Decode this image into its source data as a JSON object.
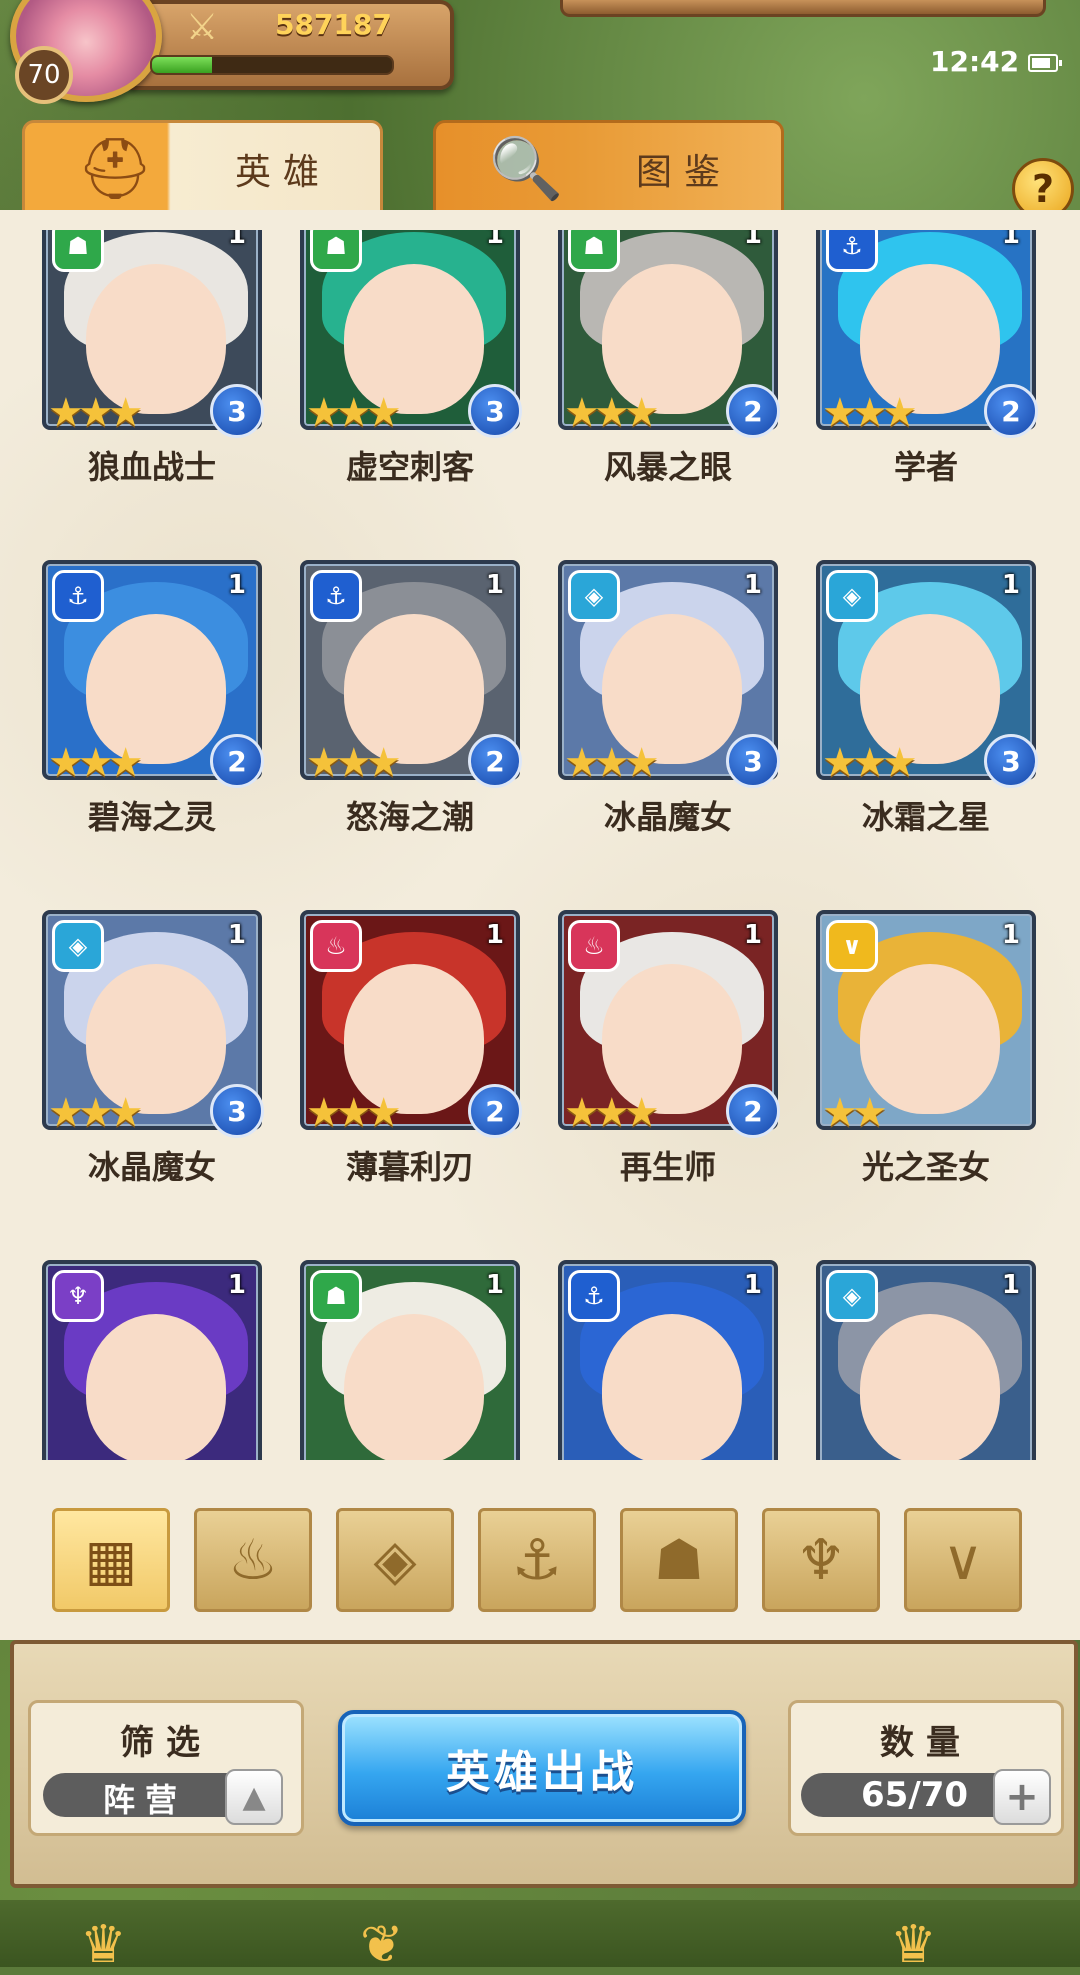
{
  "header": {
    "player_level": "70",
    "power": "587187",
    "xp_fraction": 0.25,
    "clock": "12:42"
  },
  "tabs": [
    {
      "label": "英雄",
      "icon": "helmet-icon",
      "active": true
    },
    {
      "label": "图鉴",
      "icon": "magnifier-book-icon",
      "active": false
    }
  ],
  "help_label": "?",
  "faction_colors": {
    "beast": "#2fa84a",
    "sea": "#1f5fd0",
    "ice": "#2aa6d8",
    "fire": "#d8355a",
    "light": "#f0b91d",
    "dark": "#7b3fc6"
  },
  "heroes": [
    {
      "name": "狼血战士",
      "faction": "beast",
      "count": "1",
      "stars": "★★★",
      "rank": "3",
      "hair": "#e9e6e1",
      "bg": "#3d4a5a"
    },
    {
      "name": "虚空刺客",
      "faction": "beast",
      "count": "1",
      "stars": "★★★",
      "rank": "3",
      "hair": "#27b28f",
      "bg": "#1f5e3a"
    },
    {
      "name": "风暴之眼",
      "faction": "beast",
      "count": "1",
      "stars": "★★★",
      "rank": "2",
      "hair": "#b9b7b3",
      "bg": "#2f5b3b"
    },
    {
      "name": "学者",
      "faction": "sea",
      "count": "1",
      "stars": "★★★",
      "rank": "2",
      "hair": "#2fc4ee",
      "bg": "#2773c4"
    },
    {
      "name": "碧海之灵",
      "faction": "sea",
      "count": "1",
      "stars": "★★★",
      "rank": "2",
      "hair": "#3c8ee0",
      "bg": "#2a70c9"
    },
    {
      "name": "怒海之潮",
      "faction": "sea",
      "count": "1",
      "stars": "★★★",
      "rank": "2",
      "hair": "#8b8f96",
      "bg": "#5a6370"
    },
    {
      "name": "冰晶魔女",
      "faction": "ice",
      "count": "1",
      "stars": "★★★",
      "rank": "3",
      "hair": "#cbd4ec",
      "bg": "#5c79a8"
    },
    {
      "name": "冰霜之星",
      "faction": "ice",
      "count": "1",
      "stars": "★★★",
      "rank": "3",
      "hair": "#5ec9ea",
      "bg": "#2f6d9a"
    },
    {
      "name": "冰晶魔女",
      "faction": "ice",
      "count": "1",
      "stars": "★★★",
      "rank": "3",
      "hair": "#cbd4ec",
      "bg": "#5c79a8"
    },
    {
      "name": "薄暮利刃",
      "faction": "fire",
      "count": "1",
      "stars": "★★★",
      "rank": "2",
      "hair": "#c8342a",
      "bg": "#6b1717"
    },
    {
      "name": "再生师",
      "faction": "fire",
      "count": "1",
      "stars": "★★★",
      "rank": "2",
      "hair": "#e9e7e4",
      "bg": "#7a2424"
    },
    {
      "name": "光之圣女",
      "faction": "light",
      "count": "1",
      "stars": "★★",
      "rank": "",
      "hair": "#e9b338",
      "bg": "#7ea7c7"
    },
    {
      "name": "",
      "faction": "dark",
      "count": "1",
      "stars": "",
      "rank": "",
      "hair": "#6a3bc4",
      "bg": "#3c2a7d"
    },
    {
      "name": "",
      "faction": "beast",
      "count": "1",
      "stars": "",
      "rank": "",
      "hair": "#eeece3",
      "bg": "#2f6a3a"
    },
    {
      "name": "",
      "faction": "sea",
      "count": "1",
      "stars": "",
      "rank": "",
      "hair": "#2b66d4",
      "bg": "#2a5eb8"
    },
    {
      "name": "",
      "faction": "ice",
      "count": "1",
      "stars": "",
      "rank": "",
      "hair": "#8c95a6",
      "bg": "#3a5f8c"
    }
  ],
  "faction_filters": [
    {
      "icon": "all-grid-icon",
      "active": true
    },
    {
      "icon": "fire-leaf-icon",
      "active": false
    },
    {
      "icon": "ice-crystal-icon",
      "active": false
    },
    {
      "icon": "anchor-icon",
      "active": false
    },
    {
      "icon": "beast-icon",
      "active": false
    },
    {
      "icon": "dark-horns-icon",
      "active": false
    },
    {
      "icon": "light-wings-icon",
      "active": false
    }
  ],
  "filter": {
    "title": "筛选",
    "value": "阵营"
  },
  "deploy_label": "英雄出战",
  "quantity": {
    "title": "数量",
    "value": "65/70"
  }
}
